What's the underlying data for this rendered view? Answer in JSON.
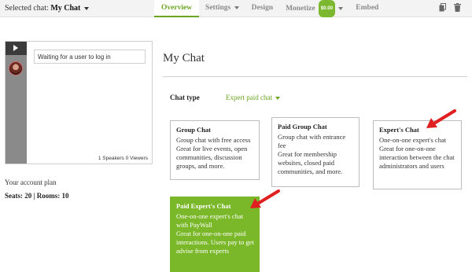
{
  "topbar": {
    "selected_chat_label": "Selected chat:",
    "selected_chat_name": "My Chat",
    "nav": [
      {
        "label": "Overview",
        "active": true,
        "has_caret": false
      },
      {
        "label": "Settings",
        "active": false,
        "has_caret": true
      },
      {
        "label": "Design",
        "active": false,
        "has_caret": false
      },
      {
        "label": "Monetize",
        "active": false,
        "has_caret": true,
        "badge": "$0.00"
      },
      {
        "label": "Embed",
        "active": false,
        "has_caret": false
      }
    ],
    "icons": [
      "copy-icon",
      "trash-icon"
    ]
  },
  "widget": {
    "status_text": "Waiting for a user to log in",
    "speakers": "1 Speakers",
    "viewers": "0 Viewers",
    "icons": [
      "play-icon",
      "user-avatar"
    ]
  },
  "account": {
    "plan_label": "Your account plan",
    "seats_label": "Seats:",
    "seats": "20",
    "rooms_label": "Rooms:",
    "rooms": "10",
    "separator": "|"
  },
  "main": {
    "title": "My Chat",
    "chat_type_label": "Chat type",
    "chat_type_value": "Expert paid chat"
  },
  "cards": [
    {
      "title": "Group Chat",
      "lines": [
        "Group chat with free access",
        "Great for live events, open communities, discussion groups, and more."
      ],
      "selected": false
    },
    {
      "title": "Paid Group Chat",
      "lines": [
        "Group chat with entrance fee",
        "Great for membership websites, closed paid communities, and more."
      ],
      "selected": false
    },
    {
      "title": "Expert's Chat",
      "lines": [
        "One-on-one expert's chat",
        "Great for one-on-one interaction between the chat administrators and users"
      ],
      "selected": false
    },
    {
      "title": "Paid Expert's Chat",
      "lines": [
        "One-on-one expert's chat with PayWall",
        "Great for one-on-one paid interactions. Users pay to get advise from experts"
      ],
      "selected": true
    }
  ],
  "colors": {
    "accent_green": "#6aa521",
    "selected_card_bg": "#7ab82a",
    "annotation_arrow": "#e02020"
  }
}
